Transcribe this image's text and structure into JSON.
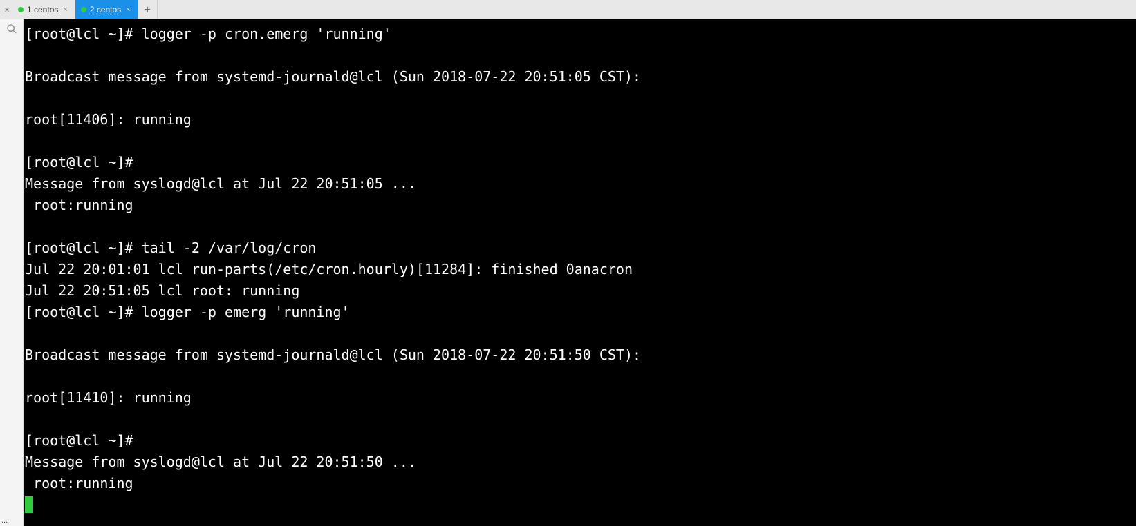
{
  "tabs": {
    "items": [
      {
        "label": "1 centos",
        "active": false,
        "dot": "green"
      },
      {
        "label": "2 centos",
        "active": true,
        "dot": "green"
      }
    ],
    "close_left": "×",
    "tab_close": "×",
    "add": "+"
  },
  "terminal": {
    "lines": [
      "[root@lcl ~]# logger -p cron.emerg 'running'",
      "",
      "Broadcast message from systemd-journald@lcl (Sun 2018-07-22 20:51:05 CST):",
      "",
      "root[11406]: running",
      "",
      "[root@lcl ~]#",
      "Message from syslogd@lcl at Jul 22 20:51:05 ...",
      " root:running",
      "",
      "[root@lcl ~]# tail -2 /var/log/cron",
      "Jul 22 20:01:01 lcl run-parts(/etc/cron.hourly)[11284]: finished 0anacron",
      "Jul 22 20:51:05 lcl root: running",
      "[root@lcl ~]# logger -p emerg 'running'",
      "",
      "Broadcast message from systemd-journald@lcl (Sun 2018-07-22 20:51:50 CST):",
      "",
      "root[11410]: running",
      "",
      "[root@lcl ~]#",
      "Message from syslogd@lcl at Jul 22 20:51:50 ...",
      " root:running"
    ]
  },
  "status": {
    "ellipsis": "..."
  }
}
